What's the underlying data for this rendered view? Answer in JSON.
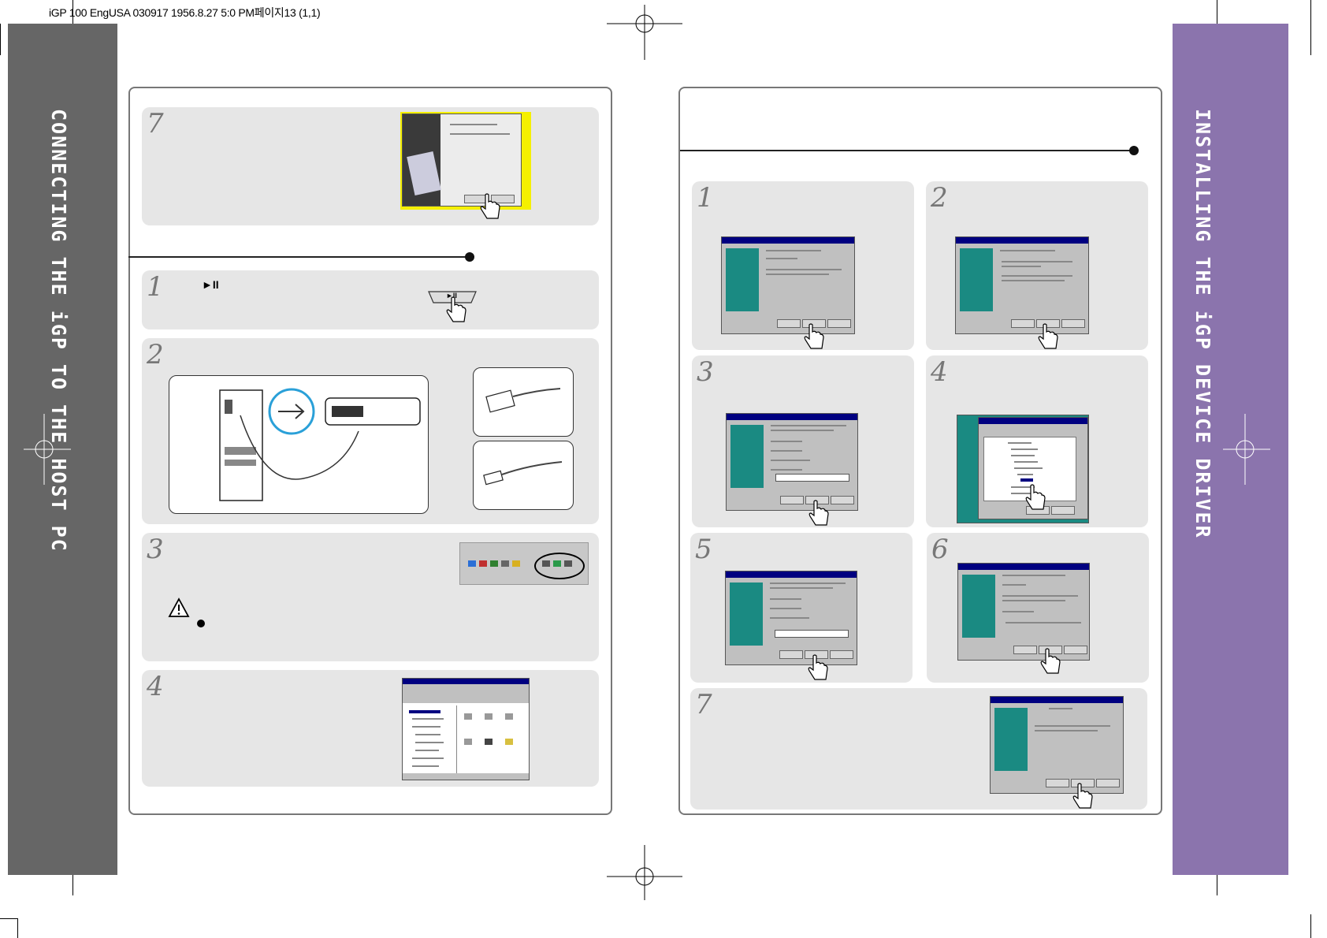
{
  "header": {
    "print_line": "iGP 100 EngUSA 030917 1956.8.27 5:0 PM페이지13 (1,1)"
  },
  "left_sidebar": {
    "title": "CONNECTING THE iGP TO THE HOST PC",
    "color": "#666666"
  },
  "right_sidebar": {
    "title": "INSTALLING THE iGP DEVICE DRIVER",
    "color": "#8b74ad"
  },
  "left_page": {
    "top_step": {
      "number": "7"
    },
    "steps": [
      {
        "number": "1",
        "button_symbol": "►II",
        "device_button_label": "►II"
      },
      {
        "number": "2"
      },
      {
        "number": "3"
      },
      {
        "number": "4"
      }
    ]
  },
  "right_page": {
    "steps": [
      {
        "number": "1"
      },
      {
        "number": "2"
      },
      {
        "number": "3"
      },
      {
        "number": "4"
      },
      {
        "number": "5"
      },
      {
        "number": "6"
      },
      {
        "number": "7"
      }
    ]
  },
  "icons": {
    "warning": "warning-icon",
    "hand": "hand-pointer-icon",
    "usb": "usb-icon",
    "bullet": "bullet-icon"
  },
  "colors": {
    "highlight": "#f5f000",
    "wizard_teal": "#1a8a82",
    "title_bar": "#000080"
  }
}
